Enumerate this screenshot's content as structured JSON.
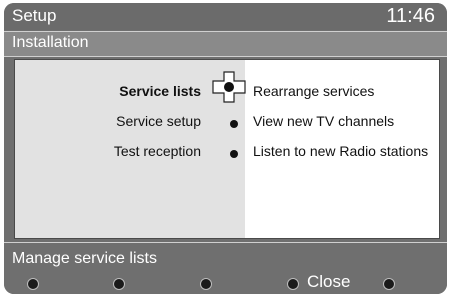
{
  "header": {
    "title": "Setup",
    "clock": "11:46"
  },
  "subheader": {
    "title": "Installation"
  },
  "menu": {
    "items": [
      {
        "label": "Service lists",
        "selected": true
      },
      {
        "label": "Service setup",
        "selected": false
      },
      {
        "label": "Test reception",
        "selected": false
      }
    ]
  },
  "submenu": {
    "options": [
      {
        "label": "Rearrange services"
      },
      {
        "label": "View new TV channels"
      },
      {
        "label": "Listen to new Radio stations"
      }
    ]
  },
  "footer": {
    "hint": "Manage service lists",
    "softkeys": [
      {
        "label": ""
      },
      {
        "label": ""
      },
      {
        "label": ""
      },
      {
        "label": "Close"
      },
      {
        "label": ""
      }
    ]
  },
  "colors": {
    "background": "#6f6f6f",
    "panel": "#e2e2e2",
    "text": "#111111"
  },
  "icons": {
    "cursor": "navigation-cross-icon",
    "bullet": "dot-icon"
  }
}
